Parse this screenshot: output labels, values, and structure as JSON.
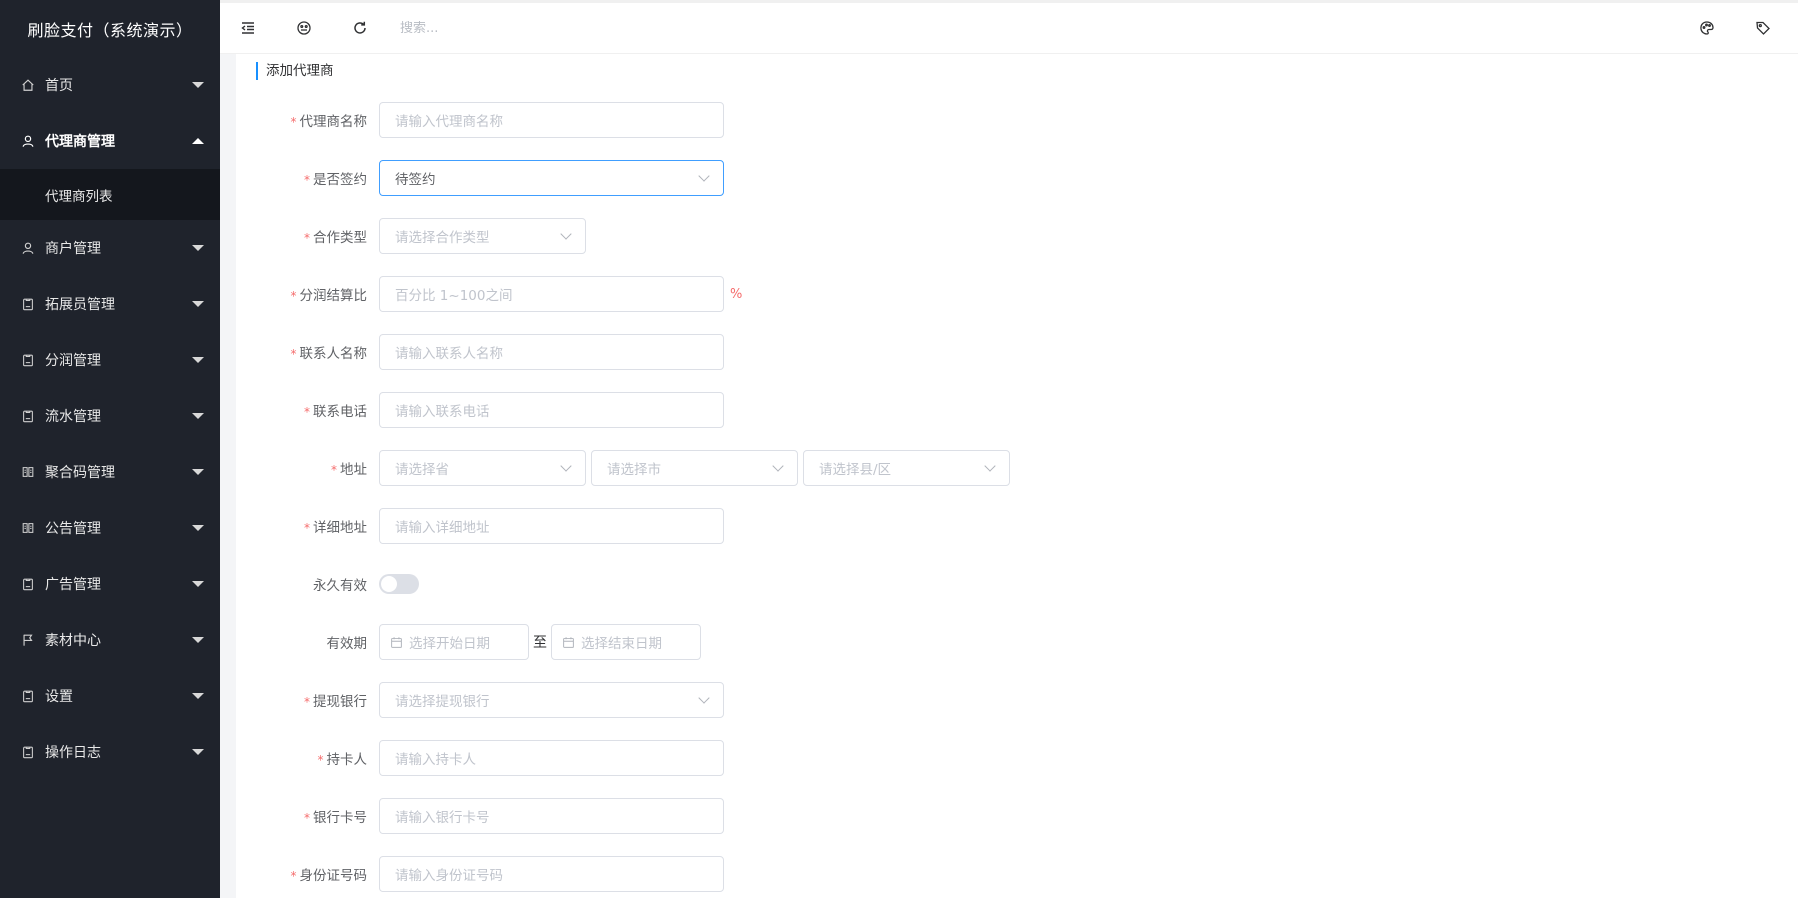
{
  "sidebar": {
    "brand": "刷脸支付（系统演示）",
    "items": [
      {
        "label": "首页",
        "icon": "home-icon",
        "expanded": false
      },
      {
        "label": "代理商管理",
        "icon": "user-icon",
        "expanded": true,
        "children": [
          "代理商列表"
        ]
      },
      {
        "label": "商户管理",
        "icon": "user-icon",
        "expanded": false
      },
      {
        "label": "拓展员管理",
        "icon": "clipboard-icon",
        "expanded": false
      },
      {
        "label": "分润管理",
        "icon": "clipboard-icon",
        "expanded": false
      },
      {
        "label": "流水管理",
        "icon": "clipboard-icon",
        "expanded": false
      },
      {
        "label": "聚合码管理",
        "icon": "book-icon",
        "expanded": false
      },
      {
        "label": "公告管理",
        "icon": "book-icon",
        "expanded": false
      },
      {
        "label": "广告管理",
        "icon": "clipboard-icon",
        "expanded": false
      },
      {
        "label": "素材中心",
        "icon": "flag-icon",
        "expanded": false
      },
      {
        "label": "设置",
        "icon": "clipboard-icon",
        "expanded": false
      },
      {
        "label": "操作日志",
        "icon": "clipboard-icon",
        "expanded": false
      }
    ]
  },
  "header": {
    "search_placeholder": "搜索...",
    "left_icons": [
      "menu-fold-icon",
      "palette-icon",
      "refresh-icon"
    ],
    "right_icons": [
      "theme-icon",
      "tag-icon"
    ]
  },
  "form": {
    "title": "添加代理商",
    "fields": {
      "agent_name": {
        "label": "代理商名称",
        "placeholder": "请输入代理商名称"
      },
      "signed": {
        "label": "是否签约",
        "value": "待签约"
      },
      "coop_type": {
        "label": "合作类型",
        "placeholder": "请选择合作类型"
      },
      "ratio": {
        "label": "分润结算比",
        "placeholder": "百分比 1~100之间",
        "suffix": "%"
      },
      "contact_name": {
        "label": "联系人名称",
        "placeholder": "请输入联系人名称"
      },
      "contact_phone": {
        "label": "联系电话",
        "placeholder": "请输入联系电话"
      },
      "address": {
        "label": "地址",
        "province": "请选择省",
        "city": "请选择市",
        "district": "请选择县/区"
      },
      "detail_address": {
        "label": "详细地址",
        "placeholder": "请输入详细地址"
      },
      "permanent": {
        "label": "永久有效",
        "on": false
      },
      "validity": {
        "label": "有效期",
        "start": "选择开始日期",
        "separator": "至",
        "end": "选择结束日期"
      },
      "bank": {
        "label": "提现银行",
        "placeholder": "请选择提现银行"
      },
      "holder": {
        "label": "持卡人",
        "placeholder": "请输入持卡人"
      },
      "card_no": {
        "label": "银行卡号",
        "placeholder": "请输入银行卡号"
      },
      "id_no": {
        "label": "身份证号码",
        "placeholder": "请输入身份证号码"
      }
    }
  },
  "colors": {
    "sidebar_bg": "#1f232c",
    "submenu_bg": "#14171d",
    "accent": "#1890ff",
    "focus_border": "#409eff",
    "required": "#f56c6c"
  }
}
